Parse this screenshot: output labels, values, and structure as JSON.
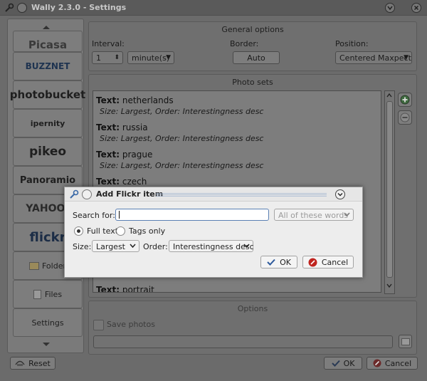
{
  "window": {
    "title": "Wally 2.3.0 - Settings"
  },
  "providers": [
    {
      "name": "Picasa"
    },
    {
      "name": "BUZZNET"
    },
    {
      "name": "photobucket"
    },
    {
      "name": "ipernity"
    },
    {
      "name": "pikeo"
    },
    {
      "name": "Panoramio"
    },
    {
      "name": "YAHOO!"
    },
    {
      "name": "flickr"
    },
    {
      "name": "Folder"
    },
    {
      "name": "Files"
    },
    {
      "name": "Settings"
    }
  ],
  "general_options": {
    "title": "General options",
    "interval_label": "Interval:",
    "interval_value": "1",
    "interval_unit": "minute(s)",
    "border_label": "Border:",
    "border_value": "Auto",
    "position_label": "Position:",
    "position_value": "Centered Maxpect"
  },
  "photo_sets": {
    "title": "Photo sets",
    "items": [
      {
        "text_label": "Text:",
        "text": "netherlands",
        "desc": "Size: Largest,  Order: Interestingness desc"
      },
      {
        "text_label": "Text:",
        "text": "russia",
        "desc": "Size: Largest,  Order: Interestingness desc"
      },
      {
        "text_label": "Text:",
        "text": "prague",
        "desc": "Size: Largest,  Order: Interestingness desc"
      },
      {
        "text_label": "Text:",
        "text": "czech",
        "desc": ""
      },
      {
        "text_label": "Text:",
        "text": "portrait",
        "desc": ""
      }
    ]
  },
  "options": {
    "title": "Options",
    "save_photos_label": "Save photos"
  },
  "bottom": {
    "reset_label": "Reset",
    "ok_label": "OK",
    "cancel_label": "Cancel"
  },
  "dialog": {
    "title": "Add Flickr item",
    "search_label": "Search for:",
    "search_value": "",
    "match_value": "All of these words",
    "full_text_label": "Full text",
    "tags_only_label": "Tags only",
    "size_label": "Size:",
    "size_value": "Largest",
    "order_label": "Order:",
    "order_value": "Interestingness desc",
    "ok_label": "OK",
    "cancel_label": "Cancel"
  }
}
